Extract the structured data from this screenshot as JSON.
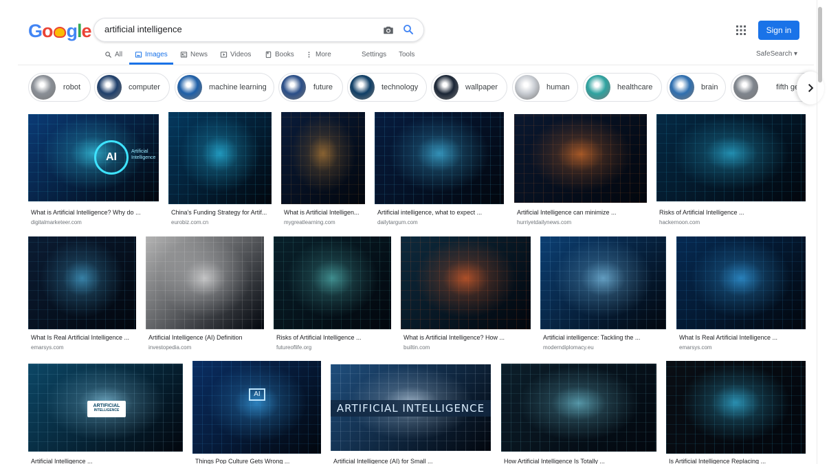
{
  "header": {
    "logo_letters": [
      "G",
      "o",
      "g",
      "l",
      "e"
    ],
    "query": "artificial intelligence",
    "sign_in": "Sign in",
    "safesearch": "SafeSearch ▾"
  },
  "tabs": [
    {
      "label": "All",
      "icon": "search-icon",
      "active": false
    },
    {
      "label": "Images",
      "icon": "image-icon",
      "active": true
    },
    {
      "label": "News",
      "icon": "news-icon",
      "active": false
    },
    {
      "label": "Videos",
      "icon": "play-icon",
      "active": false
    },
    {
      "label": "Books",
      "icon": "book-icon",
      "active": false
    },
    {
      "label": "More",
      "icon": "more-vert-icon",
      "active": false
    },
    {
      "label": "Settings",
      "icon": "",
      "active": false
    },
    {
      "label": "Tools",
      "icon": "",
      "active": false
    }
  ],
  "chips": [
    {
      "label": "robot",
      "color": "#8a8f96"
    },
    {
      "label": "computer",
      "color": "#1f3f6b"
    },
    {
      "label": "machine learning",
      "color": "#1e5fa8"
    },
    {
      "label": "future",
      "color": "#2a4e88"
    },
    {
      "label": "technology",
      "color": "#0f3e66"
    },
    {
      "label": "wallpaper",
      "color": "#1b2636"
    },
    {
      "label": "human",
      "color": "#c8ccd2"
    },
    {
      "label": "healthcare",
      "color": "#2fa3a0"
    },
    {
      "label": "brain",
      "color": "#2f6fb0"
    },
    {
      "label": "fifth gener",
      "color": "#7f858d"
    }
  ],
  "rows": [
    [
      {
        "title": "What is Artificial Intelligence? Why do ...",
        "source": "digitalmarketeer.com",
        "color": "#0b3b76",
        "accent": "#3ee3ff"
      },
      {
        "title": "China's Funding Strategy for Artif...",
        "source": "eurobiz.com.cn",
        "color": "#05395f",
        "accent": "#2fd3ff"
      },
      {
        "title": "What is Artificial Intelligen...",
        "source": "mygreatlearning.com",
        "color": "#0a1c3a",
        "accent": "#c98a38"
      },
      {
        "title": "Artificial intelligence, what to expect ...",
        "source": "dailytargum.com",
        "color": "#071c3f",
        "accent": "#4ad0ff"
      },
      {
        "title": "Artificial Intelligence can minimize ...",
        "source": "hurriyetdailynews.com",
        "color": "#0a1830",
        "accent": "#f07a2a"
      },
      {
        "title": "Risks of Artificial Intelligence ...",
        "source": "hackernoon.com",
        "color": "#052944",
        "accent": "#31c6f0"
      }
    ],
    [
      {
        "title": "What Is Real Artificial Intelligence ...",
        "source": "emarsys.com",
        "color": "#0b1c33",
        "accent": "#4fb8e8"
      },
      {
        "title": "Artificial Intelligence (AI) Definition",
        "source": "investopedia.com",
        "color": "#b3b3b3",
        "accent": "#f4f4f4"
      },
      {
        "title": "Risks of Artificial Intelligence ...",
        "source": "futureoflife.org",
        "color": "#09202a",
        "accent": "#5bc7c4"
      },
      {
        "title": "What is Artificial Intelligence? How ...",
        "source": "builtin.com",
        "color": "#0d2a3d",
        "accent": "#ff6a2a"
      },
      {
        "title": "Artificial intelligence: Tackling the ...",
        "source": "moderndiplomacy.eu",
        "color": "#0c3f73",
        "accent": "#8fd9ff"
      },
      {
        "title": "What Is Real Artificial Intelligence ...",
        "source": "emarsys.com",
        "color": "#062a52",
        "accent": "#3bb4ff"
      }
    ],
    [
      {
        "title": "Artificial Intelligence ...",
        "source": "",
        "color": "#0c4766",
        "accent": "#9fe3ff"
      },
      {
        "title": "Things Pop Culture Gets Wrong ...",
        "source": "",
        "color": "#0a2e63",
        "accent": "#3fb4ff"
      },
      {
        "title": "Artificial Intelligence (AI) for Small ...",
        "source": "",
        "color": "#1f4e7d",
        "accent": "#dbeeff"
      },
      {
        "title": "How Artificial Intelligence Is Totally ...",
        "source": "",
        "color": "#0c1e2a",
        "accent": "#7ad4e8"
      },
      {
        "title": "Is Artificial Intelligence Replacing ...",
        "source": "",
        "color": "#0a0e14",
        "accent": "#3bd0ff"
      }
    ]
  ],
  "overlays": {
    "ai_badge": "AI",
    "ai_badge_sub": "Artificial Intelligence",
    "banner": "ARTIFICIAL INTELLIGENCE",
    "diagram_box": "ARTIFICIAL",
    "diagram_box_sub": "INTELLIGENCE",
    "chip_ai": "AI"
  }
}
